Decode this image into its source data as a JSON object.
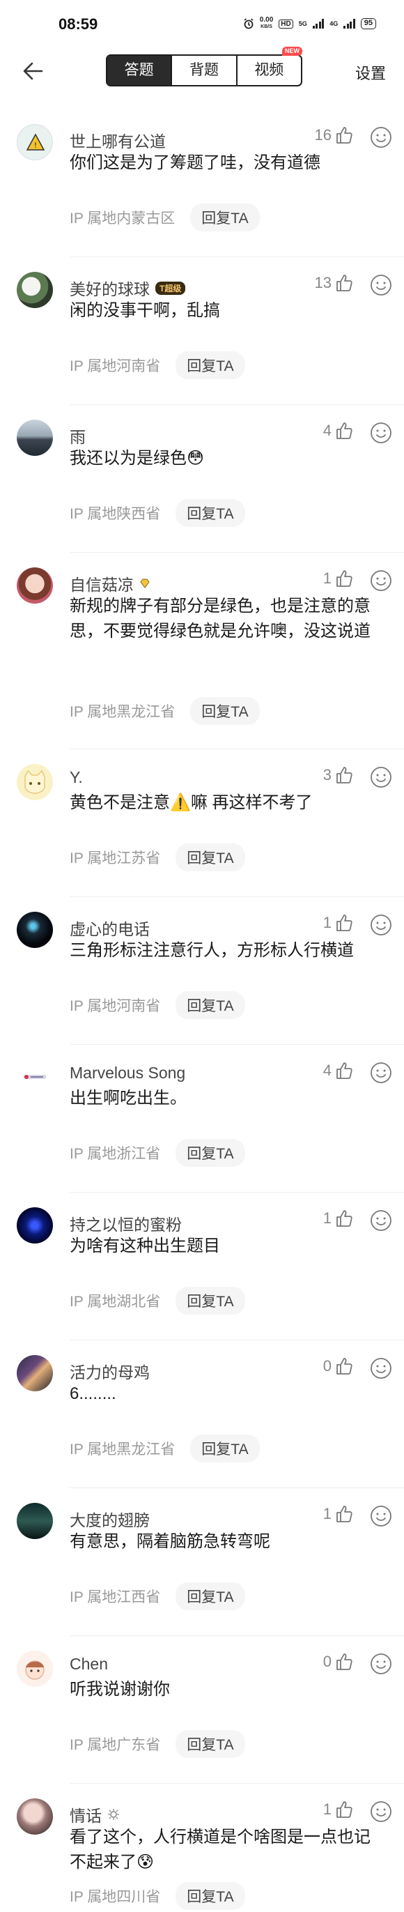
{
  "status_bar": {
    "time": "08:59",
    "net_speed_value": "0.00",
    "net_speed_unit": "KB/S",
    "hd_label": "HD",
    "sim1": "5G",
    "sim2": "4G",
    "battery": "95"
  },
  "nav": {
    "tabs": [
      {
        "label": "答题",
        "active": true
      },
      {
        "label": "背题",
        "active": false
      },
      {
        "label": "视频",
        "active": false
      }
    ],
    "new_badge": "NEW",
    "settings_label": "设置"
  },
  "comments": [
    {
      "user": "世上哪有公道",
      "text": "你们这是为了筹题了哇，没有道德",
      "likes": "16",
      "ip": "IP 属地内蒙古区",
      "reply": "回复TA"
    },
    {
      "user": "美好的球球",
      "badge": "T超级",
      "text": "闲的没事干啊，乱搞",
      "likes": "13",
      "ip": "IP 属地河南省",
      "reply": "回复TA"
    },
    {
      "user": "雨",
      "text": "我还以为是绿色😳",
      "likes": "4",
      "ip": "IP 属地陕西省",
      "reply": "回复TA"
    },
    {
      "user": "自信菇凉",
      "text": "新规的牌子有部分是绿色，也是注意的意思，不要觉得绿色就是允许噢，没这说道",
      "likes": "1",
      "ip": "IP 属地黑龙江省",
      "reply": "回复TA"
    },
    {
      "user": "Y.",
      "text": "黄色不是注意⚠️嘛 再这样不考了",
      "likes": "3",
      "ip": "IP 属地江苏省",
      "reply": "回复TA"
    },
    {
      "user": "虚心的电话",
      "text": "三角形标注注意行人，方形标人行横道",
      "likes": "1",
      "ip": "IP 属地河南省",
      "reply": "回复TA"
    },
    {
      "user": "Marvelous Song",
      "text": "出生啊吃出生。",
      "likes": "4",
      "ip": "IP 属地浙江省",
      "reply": "回复TA"
    },
    {
      "user": "持之以恒的蜜粉",
      "text": "为啥有这种出生题目",
      "likes": "1",
      "ip": "IP 属地湖北省",
      "reply": "回复TA"
    },
    {
      "user": "活力的母鸡",
      "text": "6........",
      "likes": "0",
      "ip": "IP 属地黑龙江省",
      "reply": "回复TA"
    },
    {
      "user": "大度的翅膀",
      "text": "有意思，隔着脑筋急转弯呢",
      "likes": "1",
      "ip": "IP 属地江西省",
      "reply": "回复TA"
    },
    {
      "user": "Chen",
      "text": "听我说谢谢你",
      "likes": "0",
      "ip": "IP 属地广东省",
      "reply": "回复TA"
    },
    {
      "user": "情话",
      "text": "看了这个，人行横道是个啥图是一点也记不起来了😰",
      "likes": "1",
      "ip": "IP 属地四川省",
      "reply": "回复TA"
    }
  ]
}
